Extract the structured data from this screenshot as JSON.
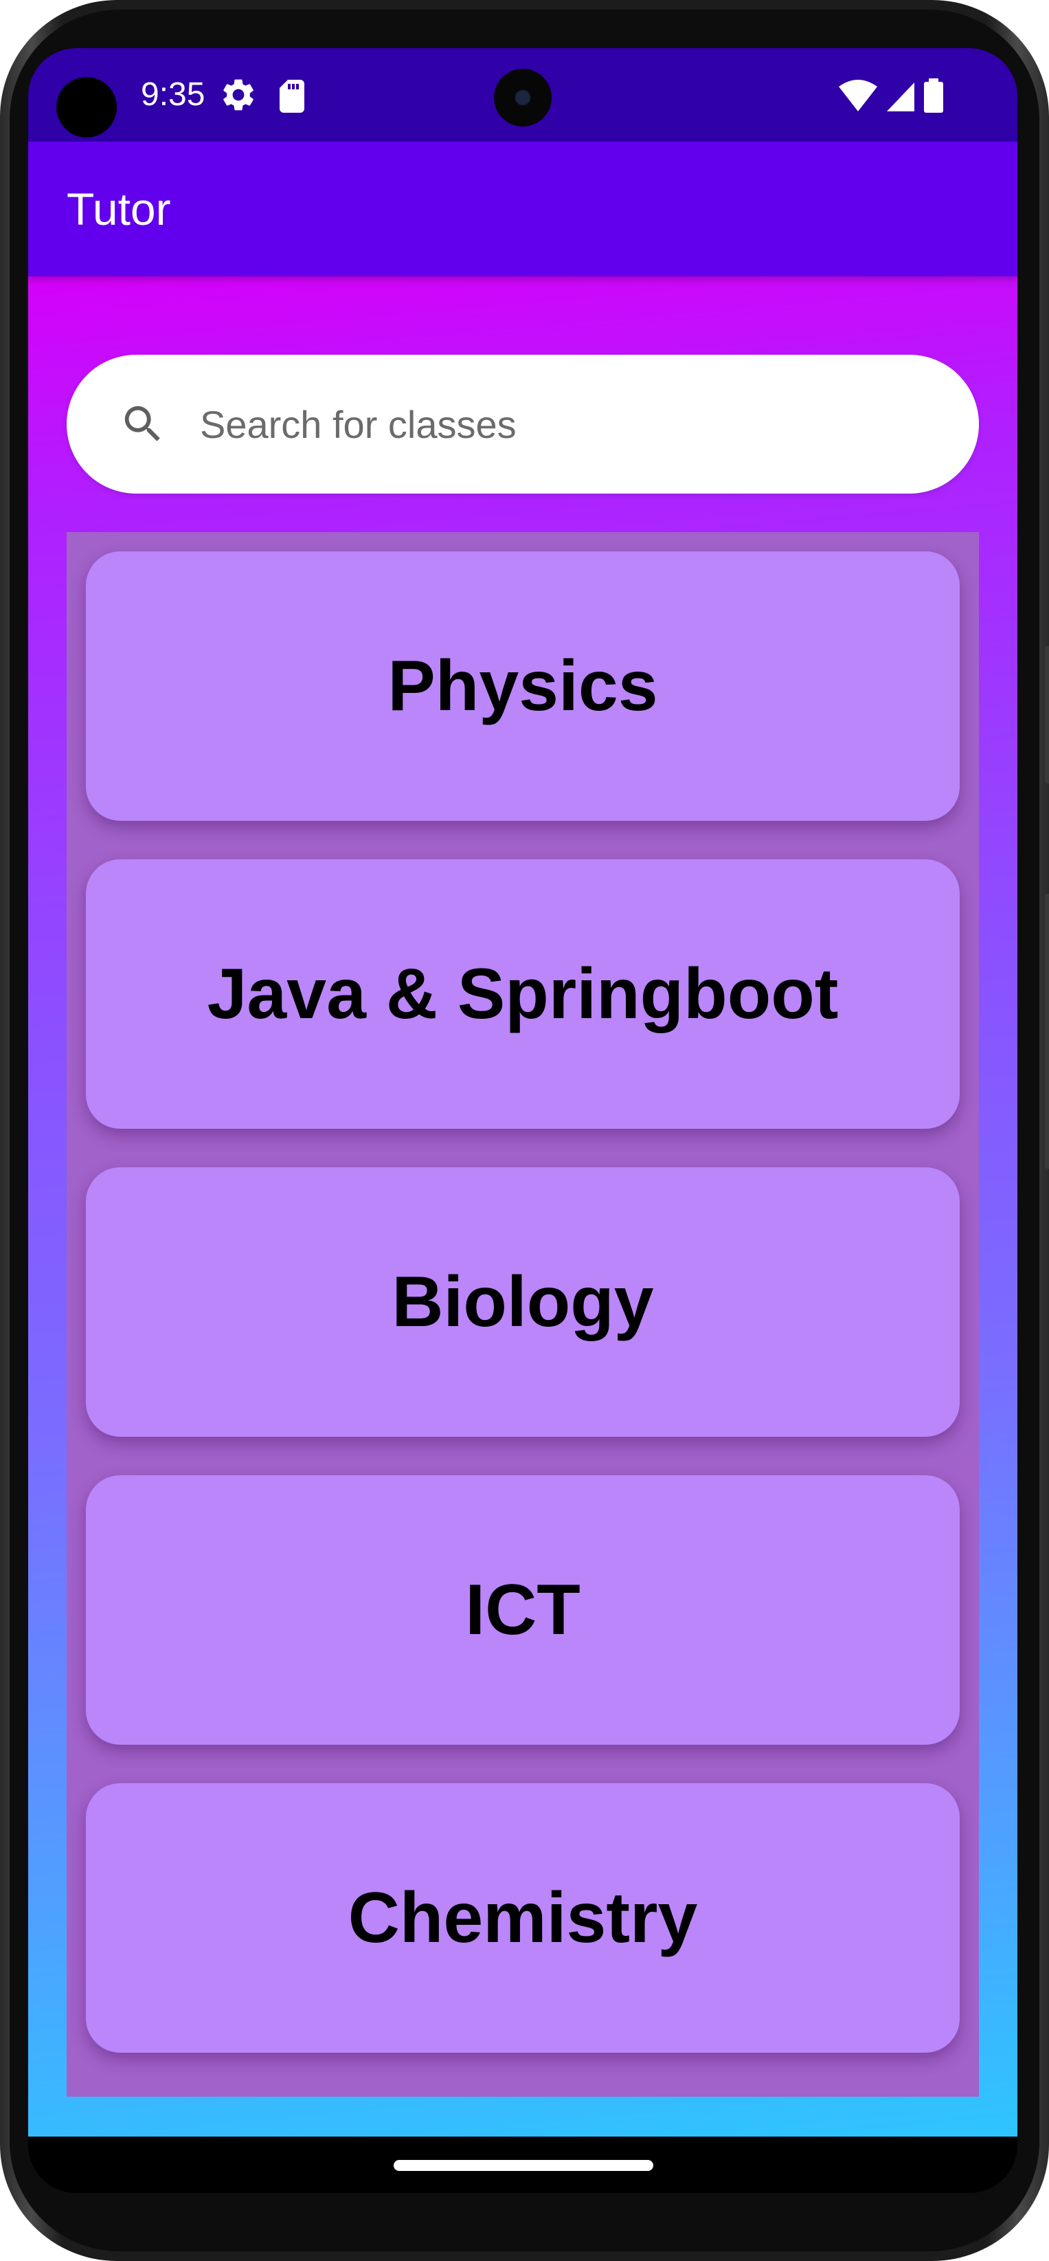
{
  "status_bar": {
    "time": "9:35",
    "icons": [
      "settings-gear-icon",
      "sd-card-icon",
      "wifi-icon",
      "cellular-signal-icon",
      "battery-icon"
    ]
  },
  "app_bar": {
    "title": "Tutor"
  },
  "search": {
    "placeholder": "Search for classes",
    "value": "",
    "icon": "search-icon"
  },
  "classes": [
    {
      "label": "Physics"
    },
    {
      "label": "Java & Springboot"
    },
    {
      "label": "Biology"
    },
    {
      "label": "ICT"
    },
    {
      "label": "Chemistry"
    }
  ],
  "colors": {
    "status_bar": "#3000a8",
    "app_bar": "#6200ee",
    "gradient_top": "#d500f9",
    "gradient_bottom": "#2ec5ff",
    "list_panel": "#a162c9",
    "card": "#ba86f9"
  }
}
